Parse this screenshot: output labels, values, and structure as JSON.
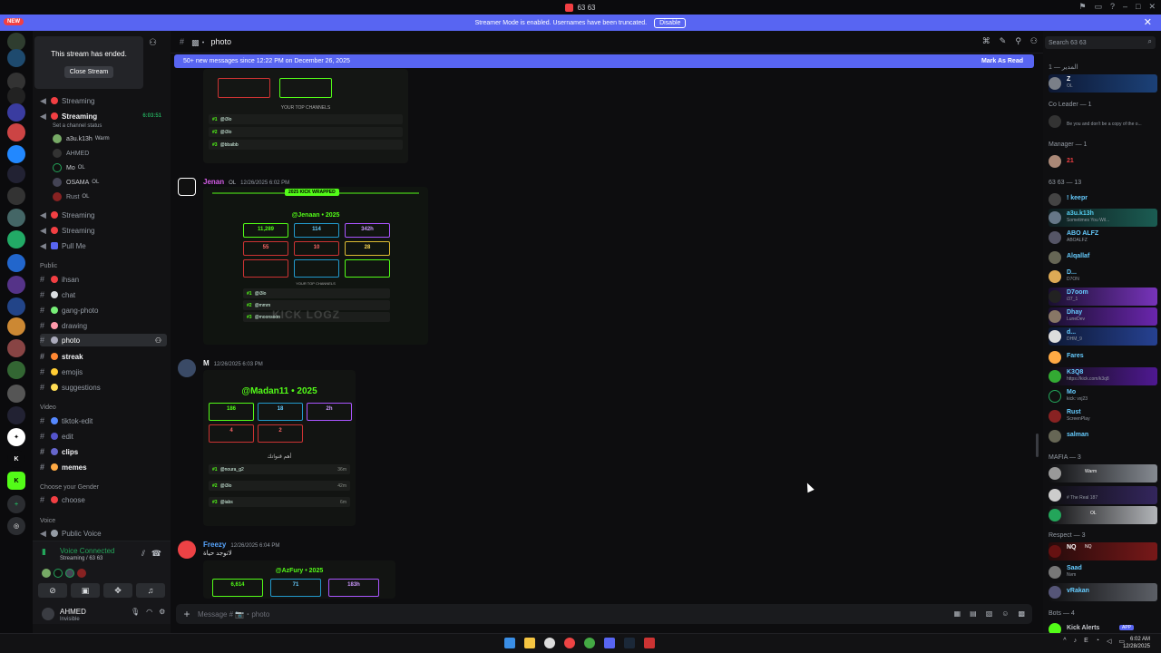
{
  "window": {
    "title": "63 63",
    "banner": "Streamer Mode is enabled. Usernames have been truncated.",
    "banner_button": "Disable",
    "new_badge": "NEW"
  },
  "stream_ended": {
    "title": "This stream has ended.",
    "button": "Close Stream"
  },
  "channels": {
    "items": [
      {
        "label": "Streaming",
        "type": "voice"
      },
      {
        "label": "Streaming",
        "type": "voice-live",
        "time": "6:03:51",
        "status": "Set a channel status"
      },
      {
        "label": "Streaming",
        "type": "voice"
      },
      {
        "label": "Streaming",
        "type": "voice"
      },
      {
        "label": "Pull Me",
        "type": "voice"
      }
    ],
    "voice_members": [
      {
        "name": "a3u.k13h",
        "badge": "Warm"
      },
      {
        "name": "AHMED",
        "badge": ""
      },
      {
        "name": "Mo",
        "badge": "OL"
      },
      {
        "name": "OSAMA",
        "badge": "OL"
      },
      {
        "name": "Rust",
        "badge": "OL"
      }
    ],
    "public_label": "Public",
    "public": [
      {
        "label": "ihsan"
      },
      {
        "label": "chat"
      },
      {
        "label": "gang-photo"
      },
      {
        "label": "drawing"
      },
      {
        "label": "photo",
        "active": true
      },
      {
        "label": "streak",
        "bold": true
      },
      {
        "label": "emojis"
      },
      {
        "label": "suggestions"
      }
    ],
    "video_label": "Video",
    "video": [
      {
        "label": "tiktok-edit"
      },
      {
        "label": "edit"
      },
      {
        "label": "clips",
        "bold": true
      },
      {
        "label": "memes",
        "bold": true
      }
    ],
    "gender_label": "Choose your Gender",
    "gender": [
      {
        "label": "choose"
      }
    ],
    "voice_label": "Voice",
    "voice": [
      {
        "label": "Public Voice"
      }
    ]
  },
  "voice_panel": {
    "title": "Voice Connected",
    "sub": "Streaming / 63 63"
  },
  "user": {
    "name": "AHMED",
    "status": "Invisible"
  },
  "header": {
    "channel": "photo"
  },
  "new_messages": {
    "text": "50+ new messages since 12:22 PM on December 26, 2025",
    "action": "Mark As Read"
  },
  "messages": [
    {
      "author": "Jenan",
      "tag": "OL",
      "time": "12/26/2025 6:02 PM",
      "handle": "@Jenaan • 2025",
      "wrapped": "2025 KICK WRAPPED",
      "stats": [
        "11,289",
        "114",
        "342h",
        "55",
        "10",
        "28"
      ],
      "ranks": [
        {
          "n": "#1",
          "name": "@i3lo"
        },
        {
          "n": "#2",
          "name": "@mmm"
        },
        {
          "n": "#3",
          "name": "@moonsoon"
        }
      ],
      "section": "YOUR TOP CHANNELS",
      "watermark": "KICK LOGZ"
    },
    {
      "author": "M",
      "tag": "",
      "time": "12/26/2025 6:03 PM",
      "handle": "@Madan11 • 2025",
      "stats": [
        "186",
        "18",
        "2h",
        "4",
        "2"
      ],
      "ranks": [
        {
          "n": "#1",
          "name": "@noura_g2",
          "v": "36m"
        },
        {
          "n": "#2",
          "name": "@i3lo",
          "v": "42m"
        },
        {
          "n": "#3",
          "name": "@iabs",
          "v": "6m"
        }
      ],
      "section": "أهم قنواتك"
    },
    {
      "author": "Freezy",
      "tag": "",
      "time": "12/26/2025 6:04 PM",
      "text": "لاتوجد حياة",
      "handle": "@AzFury • 2025",
      "stats": [
        "6,614",
        "71",
        "183h"
      ]
    }
  ],
  "top_card": {
    "section": "YOUR TOP CHANNELS",
    "ranks": [
      {
        "n": "#1",
        "name": "@i3lo"
      },
      {
        "n": "#2",
        "name": "@i3lo"
      },
      {
        "n": "#3",
        "name": "@bbaibb"
      }
    ]
  },
  "composer": {
    "placeholder": "Message # 📷・photo"
  },
  "search": {
    "placeholder": "Search 63 63"
  },
  "members": {
    "groups": [
      {
        "label": "1 — المدير",
        "members": [
          {
            "name": "Z",
            "sub": "OL"
          }
        ]
      },
      {
        "label": "Co Leader — 1",
        "members": [
          {
            "name": "",
            "sub": "Be you and don't be a copy of the o..."
          }
        ]
      },
      {
        "label": "Manager — 1",
        "members": [
          {
            "name": "21",
            "sub": ""
          }
        ]
      },
      {
        "label": "63 63 — 13",
        "members": [
          {
            "name": "! keepr",
            "sub": ""
          },
          {
            "name": "a3u.k13h",
            "sub": "Sometimes You Wil..."
          },
          {
            "name": "ABO ALFZ",
            "sub": "ABOALFZ"
          },
          {
            "name": "Alqallaf",
            "sub": ""
          },
          {
            "name": "D...",
            "sub": "D7ON"
          },
          {
            "name": "D7oom",
            "sub": "i37_1"
          },
          {
            "name": "Dhay",
            "sub": "LuneDev"
          },
          {
            "name": "d...",
            "sub": "DHM_9"
          },
          {
            "name": "Fares",
            "sub": ""
          },
          {
            "name": "K3Q8",
            "sub": "https://kick.com/k3q8"
          },
          {
            "name": "Mo",
            "sub": "kick: vxj23"
          },
          {
            "name": "Rust",
            "sub": "ScreenPlay"
          },
          {
            "name": "salman",
            "sub": ""
          }
        ]
      },
      {
        "label": "MAFIA — 3",
        "members": [
          {
            "name": "",
            "sub": "Warm"
          },
          {
            "name": "",
            "sub": "# The Real 187"
          },
          {
            "name": "",
            "sub": "OL"
          }
        ]
      },
      {
        "label": "Respect — 3",
        "members": [
          {
            "name": "NQ",
            "sub": "NQ"
          },
          {
            "name": "Saad",
            "sub": "Nvm"
          },
          {
            "name": "vRakan",
            "sub": ""
          }
        ]
      },
      {
        "label": "Bots — 4",
        "members": [
          {
            "name": "Kick Alerts",
            "sub": "APP"
          }
        ]
      }
    ]
  },
  "taskbar": {
    "time": "6:02 AM",
    "date": "12/28/2025"
  },
  "colors": {
    "accent": "#5865f2",
    "kick_green": "#53fc18",
    "online": "#23a55a"
  }
}
